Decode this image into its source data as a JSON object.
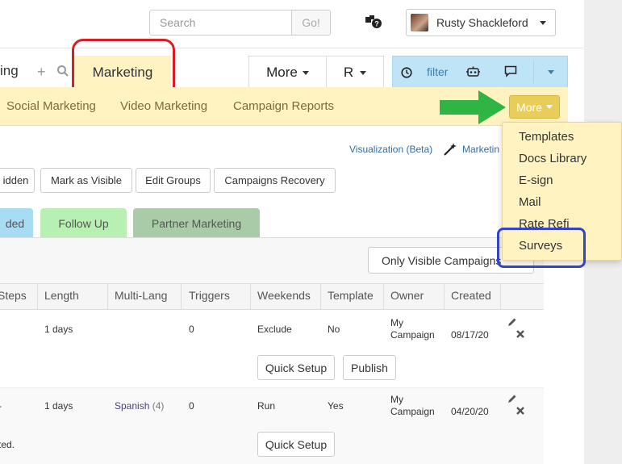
{
  "header": {
    "search_placeholder": "Search",
    "go_label": "Go!",
    "user_name": "Rusty Shackleford"
  },
  "tabs": {
    "partial_tab": "ing",
    "marketing": "Marketing",
    "more": "More",
    "r": "R",
    "filter": "filter"
  },
  "subnav": {
    "items": [
      "Social Marketing",
      "Video Marketing",
      "Campaign Reports"
    ],
    "more": "More"
  },
  "dropdown": {
    "items": [
      "Templates",
      "Docs Library",
      "E-sign",
      "Mail",
      "Rate Refi",
      "Surveys"
    ]
  },
  "links": {
    "visualization": "Visualization (Beta)",
    "marketing_partial": "Marketin"
  },
  "actions": [
    "idden",
    "Mark as Visible",
    "Edit Groups",
    "Campaigns Recovery"
  ],
  "category_tabs": [
    "ded",
    "Follow Up",
    "Partner Marketing"
  ],
  "filter_select": "Only Visible Campaigns",
  "table": {
    "headers": [
      "Steps",
      "Length",
      "Multi-Lang",
      "Triggers",
      "Weekends",
      "Template",
      "Owner",
      "Created"
    ],
    "rows": [
      {
        "length": "1 days",
        "multilang": "",
        "multilang_count": "",
        "triggers": "0",
        "weekends": "Exclude",
        "template": "No",
        "owner": "My Campaign",
        "created": "08/17/20",
        "buttons": [
          "Quick Setup",
          "Publish"
        ]
      },
      {
        "length": "1 days",
        "multilang": "Spanish",
        "multilang_count": "(4)",
        "triggers": "0",
        "weekends": "Run",
        "template": "Yes",
        "owner": "My Campaign",
        "created": "04/20/20",
        "buttons": [
          "Quick Setup"
        ],
        "note": "ted."
      }
    ]
  },
  "colors": {
    "yellow_bg": "#fff3c2",
    "more_btn": "#e8cd5a",
    "filter_blue": "#bfe3f7",
    "follow_up_green": "#b7f0b0",
    "partner_green": "#a9cba7",
    "tab_blue": "#a8dcf3",
    "red_highlight": "#d81f26",
    "blue_highlight": "#3643c7",
    "arrow_green": "#2fb544"
  },
  "icons": [
    "help-chat-icon",
    "search-icon",
    "plus-icon",
    "clock-icon",
    "robot-icon",
    "chat-icon",
    "wand-icon",
    "pencil-icon",
    "close-icon",
    "green-arrow-icon"
  ]
}
